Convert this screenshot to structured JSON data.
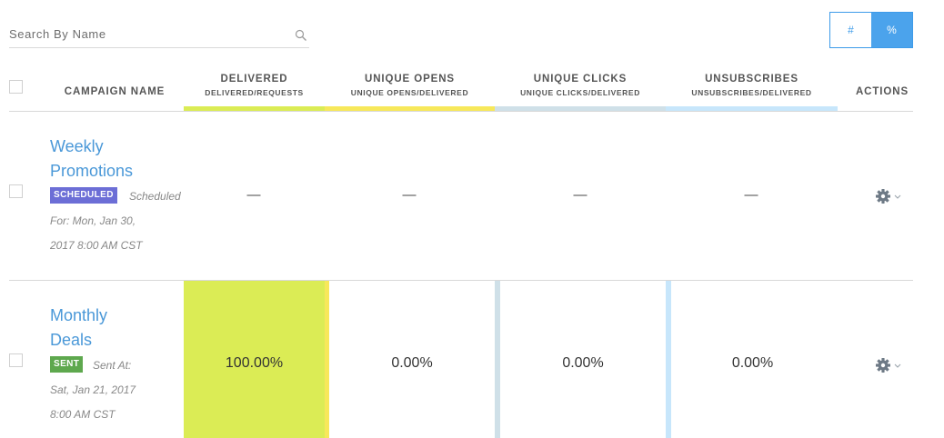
{
  "search": {
    "placeholder": "Search By Name"
  },
  "view_toggle": {
    "count_label": "#",
    "percent_label": "%",
    "selected": "%"
  },
  "columns": {
    "name": {
      "title": "CAMPAIGN NAME"
    },
    "delivered": {
      "title": "DELIVERED",
      "subtitle": "DELIVERED/REQUESTS",
      "color": "#dbec55"
    },
    "opens": {
      "title": "UNIQUE OPENS",
      "subtitle": "UNIQUE OPENS/DELIVERED",
      "color": "#f7e85a"
    },
    "clicks": {
      "title": "UNIQUE CLICKS",
      "subtitle": "UNIQUE CLICKS/DELIVERED",
      "color": "#cfe0e8"
    },
    "unsubscribes": {
      "title": "UNSUBSCRIBES",
      "subtitle": "UNSUBSCRIBES/DELIVERED",
      "color": "#c7e6fb"
    },
    "actions": {
      "title": "ACTIONS"
    }
  },
  "campaigns": [
    {
      "name_line1": "Weekly",
      "name_line2": "Promotions",
      "status_badge": "SCHEDULED",
      "status_color": "#6c6ed6",
      "status_text": "Scheduled",
      "meta_line1": "For: Mon, Jan 30,",
      "meta_line2": "2017 8:00 AM CST",
      "delivered": "—",
      "opens": "—",
      "clicks": "—",
      "unsubscribes": "—",
      "actions_icon": "gear-icon"
    },
    {
      "name_line1": "Monthly",
      "name_line2": "Deals",
      "status_badge": "SENT",
      "status_color": "#5ea84e",
      "status_text": "Sent At:",
      "meta_line1": "Sat, Jan 21, 2017",
      "meta_line2": "8:00 AM CST",
      "delivered": "100.00%",
      "opens": "0.00%",
      "clicks": "0.00%",
      "unsubscribes": "0.00%",
      "actions_icon": "gear-icon"
    }
  ]
}
